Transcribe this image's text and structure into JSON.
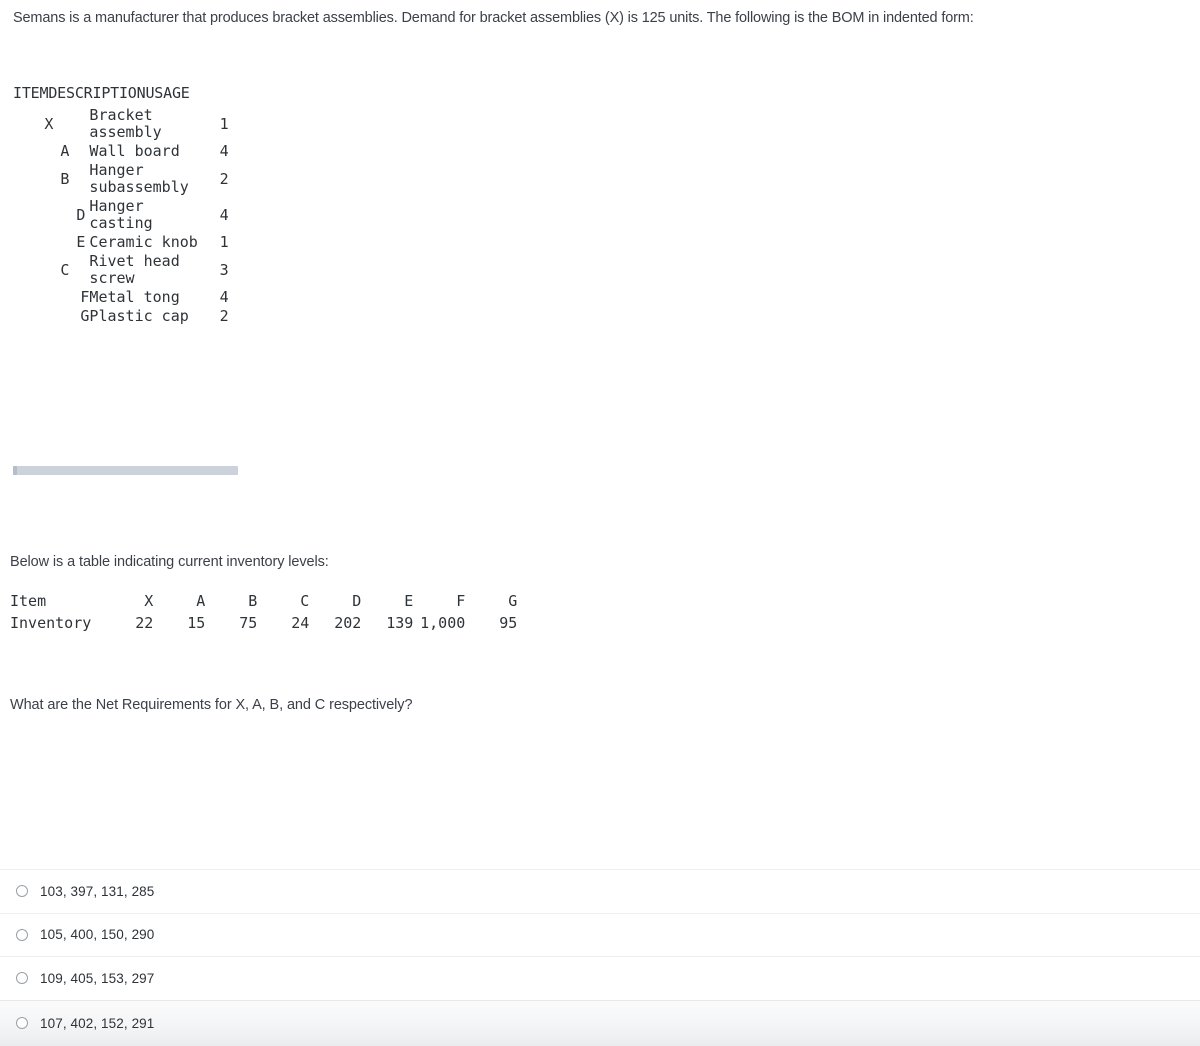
{
  "intro": {
    "text": "Semans is a manufacturer that produces bracket assemblies. Demand for bracket assemblies (X) is 125 units. The following is the BOM in indented form:"
  },
  "bom": {
    "headers": {
      "item": "ITEM",
      "description": "DESCRIPTION",
      "usage": "USAGE"
    },
    "rows": [
      {
        "item": "X",
        "level": 0,
        "description": "Bracket assembly",
        "usage": "1"
      },
      {
        "item": "A",
        "level": 1,
        "description": "Wall board",
        "usage": "4"
      },
      {
        "item": "B",
        "level": 1,
        "description": "Hanger subassembly",
        "usage": "2"
      },
      {
        "item": "D",
        "level": 2,
        "description": "Hanger casting",
        "usage": "4"
      },
      {
        "item": "E",
        "level": 2,
        "description": "Ceramic knob",
        "usage": "1"
      },
      {
        "item": "C",
        "level": 1,
        "description": "Rivet head screw",
        "usage": "3"
      },
      {
        "item": "F",
        "level": 2,
        "description": "Metal tong",
        "usage": "4"
      },
      {
        "item": "G",
        "level": 2,
        "description": "Plastic cap",
        "usage": "2"
      }
    ]
  },
  "scrollbar": {
    "track_color": "#ccd2dc",
    "thumb_color": "#b6bdc9"
  },
  "inventory_intro": {
    "text": "Below is a table indicating current inventory levels:"
  },
  "inventory": {
    "row_labels": [
      "Item",
      "Inventory"
    ],
    "items": [
      "X",
      "A",
      "B",
      "C",
      "D",
      "E",
      "F",
      "G"
    ],
    "levels": [
      "22",
      "15",
      "75",
      "24",
      "202",
      "139",
      "1,000",
      "95"
    ]
  },
  "question": {
    "text": "What are the Net Requirements for X, A, B, and C respectively?"
  },
  "options": [
    {
      "label": "103, 397, 131, 285"
    },
    {
      "label": "105, 400, 150, 290"
    },
    {
      "label": "109, 405, 153, 297"
    },
    {
      "label": "107, 402, 152, 291"
    }
  ],
  "colors": {
    "body_text": "#3b4049",
    "mono_text": "#2e3338",
    "divider": "#eceef0"
  }
}
